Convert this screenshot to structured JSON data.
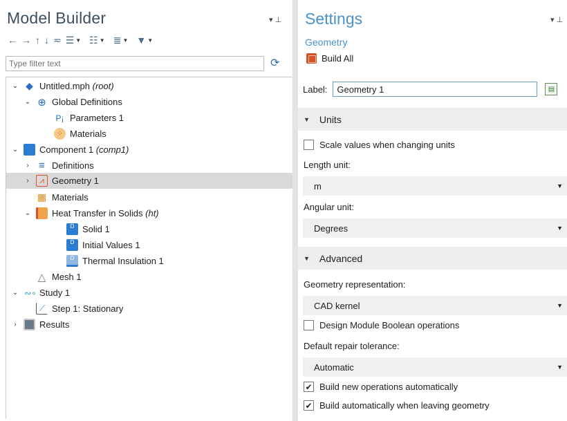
{
  "model_builder": {
    "title": "Model Builder",
    "filter_placeholder": "Type filter text",
    "toolbar_icons": [
      "back-arrow-icon",
      "forward-arrow-icon",
      "up-arrow-icon",
      "down-arrow-icon",
      "filter-icon",
      "list-icon",
      "expand-icon",
      "view-icon",
      "pin-tool-icon"
    ],
    "tree": [
      {
        "label": "Untitled.mph",
        "suffix": "(root)",
        "icon": "mph-file-icon"
      },
      {
        "label": "Global Definitions",
        "suffix": "",
        "icon": "globe-icon"
      },
      {
        "label": "Parameters 1",
        "suffix": "",
        "icon": "parameters-icon",
        "icon_text": "P¡"
      },
      {
        "label": "Materials",
        "suffix": "",
        "icon": "materials-icon"
      },
      {
        "label": "Component 1",
        "suffix": "(comp1)",
        "icon": "component-icon"
      },
      {
        "label": "Definitions",
        "suffix": "",
        "icon": "definitions-icon"
      },
      {
        "label": "Geometry 1",
        "suffix": "",
        "icon": "geometry-icon"
      },
      {
        "label": "Materials",
        "suffix": "",
        "icon": "materials-grid-icon"
      },
      {
        "label": "Heat Transfer in Solids",
        "suffix": "(ht)",
        "icon": "heat-transfer-icon"
      },
      {
        "label": "Solid 1",
        "suffix": "",
        "icon": "solid-domain-icon"
      },
      {
        "label": "Initial Values 1",
        "suffix": "",
        "icon": "initial-values-icon"
      },
      {
        "label": "Thermal Insulation 1",
        "suffix": "",
        "icon": "thermal-insulation-icon"
      },
      {
        "label": "Mesh 1",
        "suffix": "",
        "icon": "mesh-icon"
      },
      {
        "label": "Study 1",
        "suffix": "",
        "icon": "study-icon"
      },
      {
        "label": "Step 1: Stationary",
        "suffix": "",
        "icon": "stationary-step-icon"
      },
      {
        "label": "Results",
        "suffix": "",
        "icon": "results-icon"
      }
    ]
  },
  "settings": {
    "title": "Settings",
    "subtitle": "Geometry",
    "build_all": "Build All",
    "label_caption": "Label:",
    "label_value": "Geometry 1",
    "units_section": "Units",
    "scale_values": "Scale values when changing units",
    "scale_values_checked": false,
    "length_unit_caption": "Length unit:",
    "length_unit_value": "m",
    "angular_unit_caption": "Angular unit:",
    "angular_unit_value": "Degrees",
    "advanced_section": "Advanced",
    "geometry_rep_caption": "Geometry representation:",
    "geometry_rep_value": "CAD kernel",
    "design_module": "Design Module Boolean operations",
    "design_module_checked": false,
    "repair_tol_caption": "Default repair tolerance:",
    "repair_tol_value": "Automatic",
    "build_new_ops": "Build new operations automatically",
    "build_new_ops_checked": true,
    "build_leaving": "Build automatically when leaving geometry",
    "build_leaving_checked": true
  },
  "colors": {
    "settings_accent": "#4a92c9",
    "selection": "#d9d9d9",
    "section_bg": "#eeeeee"
  }
}
